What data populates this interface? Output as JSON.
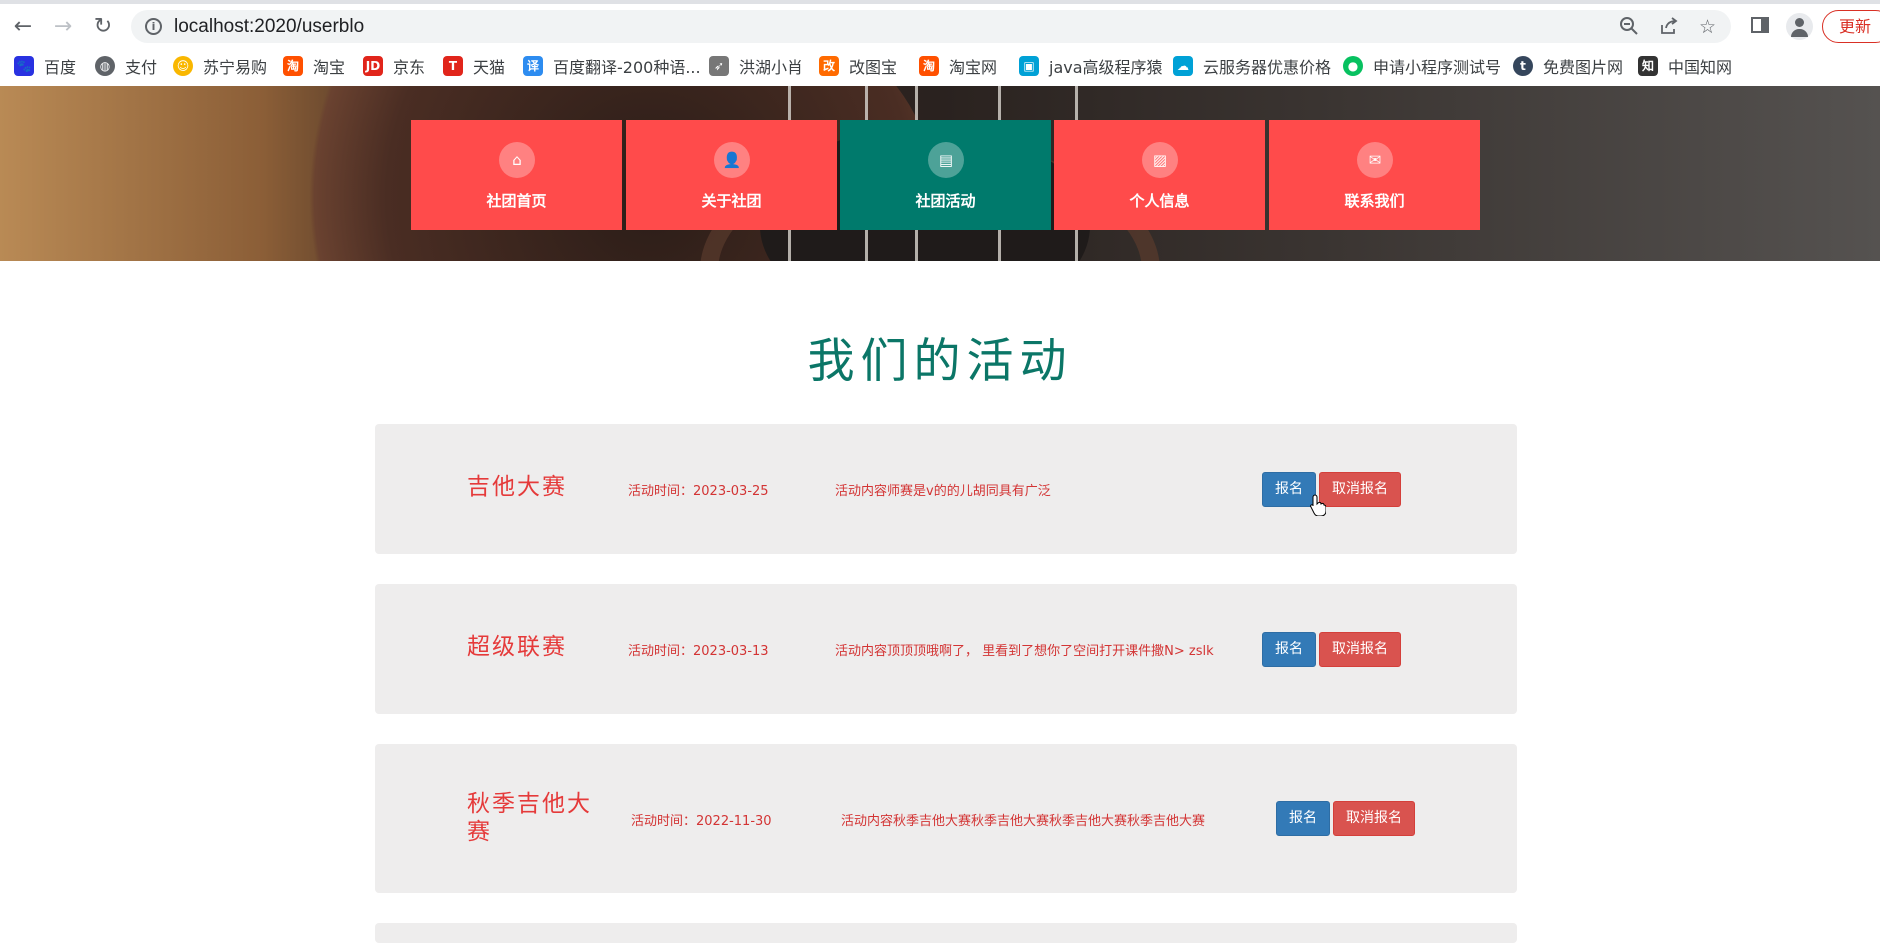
{
  "browser": {
    "url": "localhost:2020/userblo",
    "update_label": "更新",
    "bookmarks": [
      {
        "label": "百度",
        "icon": "baidu-icon",
        "color": "#2932e1"
      },
      {
        "label": "支付",
        "icon": "globe-icon",
        "color": "#5f6368"
      },
      {
        "label": "苏宁易购",
        "icon": "suning-icon",
        "color": "#f9b700"
      },
      {
        "label": "淘宝",
        "icon": "taobao-icon",
        "color": "#ff5000"
      },
      {
        "label": "京东",
        "icon": "jd-icon",
        "color": "#e1251b"
      },
      {
        "label": "天猫",
        "icon": "tmall-icon",
        "color": "#e1251b"
      },
      {
        "label": "百度翻译-200种语...",
        "icon": "translate-icon",
        "color": "#2d8cf0"
      },
      {
        "label": "洪湖小肖",
        "icon": "rocket-icon",
        "color": "#777777"
      },
      {
        "label": "改图宝",
        "icon": "gaitubao-icon",
        "color": "#ff6a00"
      },
      {
        "label": "淘宝网",
        "icon": "taobao-icon",
        "color": "#ff5000"
      },
      {
        "label": "java高级程序猿",
        "icon": "bilibili-icon",
        "color": "#00a1d6"
      },
      {
        "label": "云服务器优惠价格",
        "icon": "cloud-icon",
        "color": "#00a1d6"
      },
      {
        "label": "申请小程序测试号",
        "icon": "wechat-icon",
        "color": "#07c160"
      },
      {
        "label": "免费图片网",
        "icon": "tumblr-icon",
        "color": "#35465c"
      },
      {
        "label": "中国知网",
        "icon": "cnki-icon",
        "color": "#333333"
      }
    ]
  },
  "nav": {
    "items": [
      {
        "label": "社团首页",
        "icon": "home-icon",
        "active": false
      },
      {
        "label": "关于社团",
        "icon": "user-icon",
        "active": false
      },
      {
        "label": "社团活动",
        "icon": "list-icon",
        "active": true
      },
      {
        "label": "个人信息",
        "icon": "picture-icon",
        "active": false
      },
      {
        "label": "联系我们",
        "icon": "envelope-icon",
        "active": false
      }
    ]
  },
  "section_title": "我们的活动",
  "activities": [
    {
      "name": "吉他大赛",
      "time_label": "活动时间：2023-03-25",
      "content": "活动内容师赛是v的的儿胡同具有广泛",
      "signup_label": "报名",
      "cancel_label": "取消报名"
    },
    {
      "name": "超级联赛",
      "time_label": "活动时间：2023-03-13",
      "content": "活动内容顶顶顶哦啊了， 里看到了想你了空间打开课件撒N> zslk",
      "signup_label": "报名",
      "cancel_label": "取消报名"
    },
    {
      "name": "秋季吉他大赛",
      "time_label": "活动时间：2022-11-30",
      "content": "活动内容秋季吉他大赛秋季吉他大赛秋季吉他大赛秋季吉他大赛",
      "signup_label": "报名",
      "cancel_label": "取消报名"
    }
  ],
  "colors": {
    "nav_default": "#ff4b4b",
    "nav_active": "#007a6c",
    "title": "#0b7667",
    "activity_text": "#d33434",
    "signup_button": "#337ab7",
    "cancel_button": "#d9534f"
  }
}
